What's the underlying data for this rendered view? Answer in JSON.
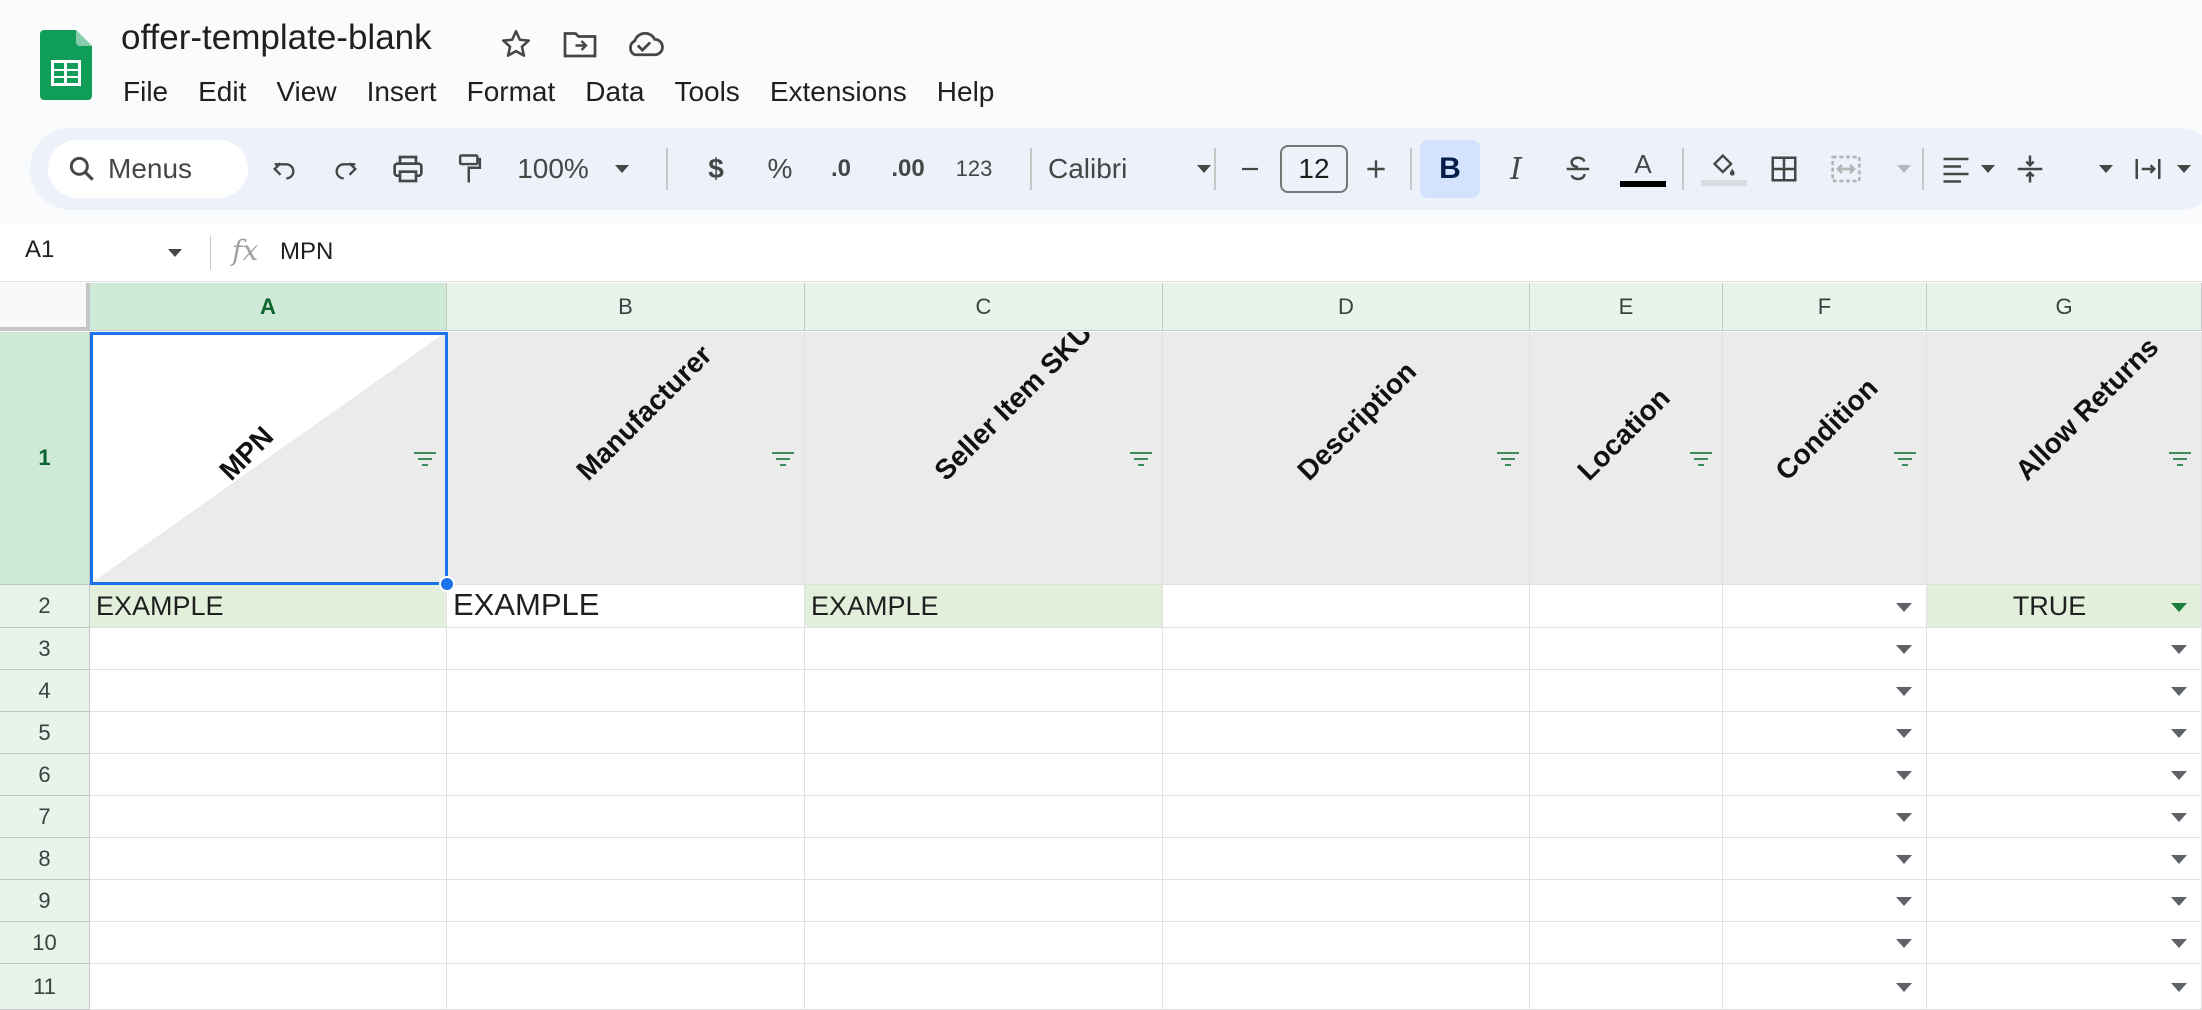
{
  "app": {
    "title": "offer-template-blank",
    "menu": [
      "File",
      "Edit",
      "View",
      "Insert",
      "Format",
      "Data",
      "Tools",
      "Extensions",
      "Help"
    ],
    "brand_color": "#0f9d58"
  },
  "toolbar": {
    "search_label": "Menus",
    "zoom": "100%",
    "currency": "$",
    "percent": "%",
    "decrease_decimals": ".0",
    "increase_decimals": ".00",
    "number_format": "123",
    "font": "Calibri",
    "font_size": "12",
    "bold": "B",
    "italic": "I",
    "text_color": "A"
  },
  "formula_bar": {
    "cell_ref": "A1",
    "fx": "fx",
    "value": "MPN"
  },
  "sheet": {
    "columns": [
      "A",
      "B",
      "C",
      "D",
      "E",
      "F",
      "G"
    ],
    "rows": [
      "1",
      "2",
      "3",
      "4",
      "5",
      "6",
      "7",
      "8",
      "9",
      "10",
      "11"
    ],
    "header_row": [
      "MPN",
      "Manufacturer",
      "Seller Item SKU",
      "Description",
      "Location",
      "Condition",
      "Allow Returns"
    ],
    "row2": {
      "a": "EXAMPLE",
      "b": "EXAMPLE",
      "c": "EXAMPLE",
      "g": "TRUE"
    },
    "selected_cell": "A1"
  }
}
